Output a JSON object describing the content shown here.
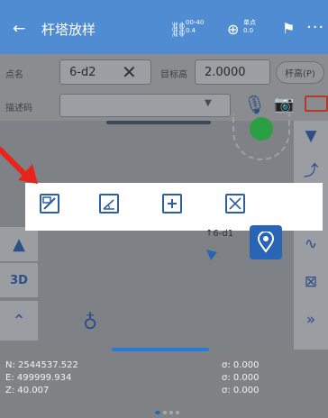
{
  "header": {
    "back_icon": "arrow-left",
    "title": "杆塔放样",
    "sat_top": "00-40",
    "sat_bottom": "0.4",
    "fix_top": "单点",
    "fix_bottom": "0.0",
    "more": "···"
  },
  "form": {
    "point_name_label": "点名",
    "point_name_value": "6-d2",
    "target_height_label": "目标高",
    "target_height_value": "2.0000",
    "height_mode_pill": "杆高(P)",
    "code_label": "描述码",
    "code_value": ""
  },
  "toolbar": {
    "tools": [
      "zoom-extents-tool-icon",
      "measure-angle-tool-icon",
      "add-point-tool-icon",
      "fit-view-tool-icon"
    ]
  },
  "map": {
    "target_label": "↑6-d1",
    "compass_label": "3D"
  },
  "coords": {
    "n": "N:  2544537.522",
    "e": "E:  499999.934",
    "z": "Z:  40.007",
    "sn": "σ:  0.000",
    "se": "σ:  0.000",
    "sz": "σ:  0.000"
  },
  "colors": {
    "header": "#4f8cd1",
    "accent": "#2a64b4",
    "fix_dot": "#2ba042",
    "annotation_arrow": "#e8231b"
  }
}
